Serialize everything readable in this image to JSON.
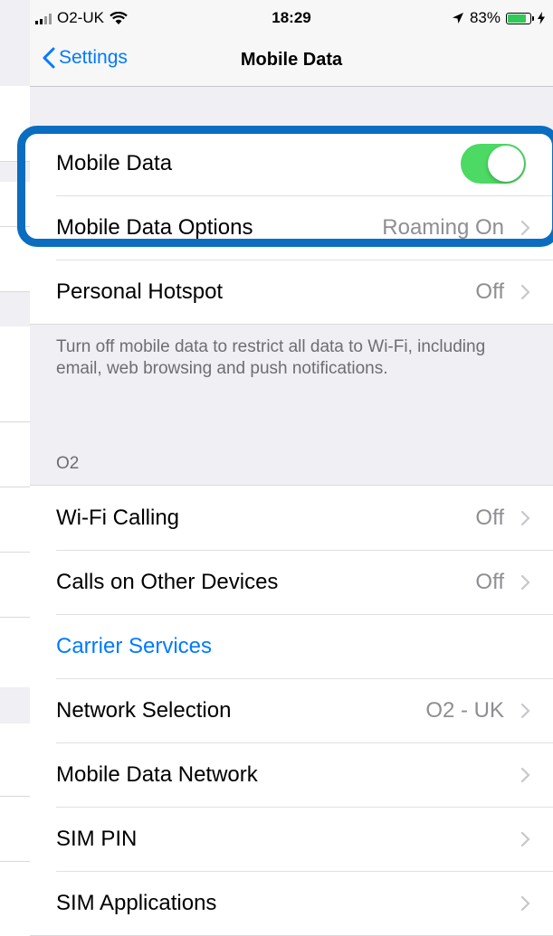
{
  "status_bar": {
    "carrier": "O2-UK",
    "time": "18:29",
    "battery": "83%",
    "battery_level": 0.83
  },
  "nav": {
    "back_label": "Settings",
    "title": "Mobile Data"
  },
  "group1": {
    "mobile_data": {
      "label": "Mobile Data",
      "on": true
    },
    "options": {
      "label": "Mobile Data Options",
      "value": "Roaming On"
    },
    "hotspot": {
      "label": "Personal Hotspot",
      "value": "Off"
    }
  },
  "footer_note": "Turn off mobile data to restrict all data to Wi-Fi, including email, web browsing and push notifications.",
  "section_o2": {
    "header": "O2",
    "wifi_calling": {
      "label": "Wi-Fi Calling",
      "value": "Off"
    },
    "calls_other": {
      "label": "Calls on Other Devices",
      "value": "Off"
    },
    "carrier_services": {
      "label": "Carrier Services"
    },
    "network_selection": {
      "label": "Network Selection",
      "value": "O2 - UK"
    },
    "mobile_data_network": {
      "label": "Mobile Data Network"
    },
    "sim_pin": {
      "label": "SIM PIN"
    },
    "sim_applications": {
      "label": "SIM Applications"
    }
  },
  "colors": {
    "accent": "#007aff",
    "toggle_on": "#4cd964",
    "highlight": "#0a6dbf"
  }
}
